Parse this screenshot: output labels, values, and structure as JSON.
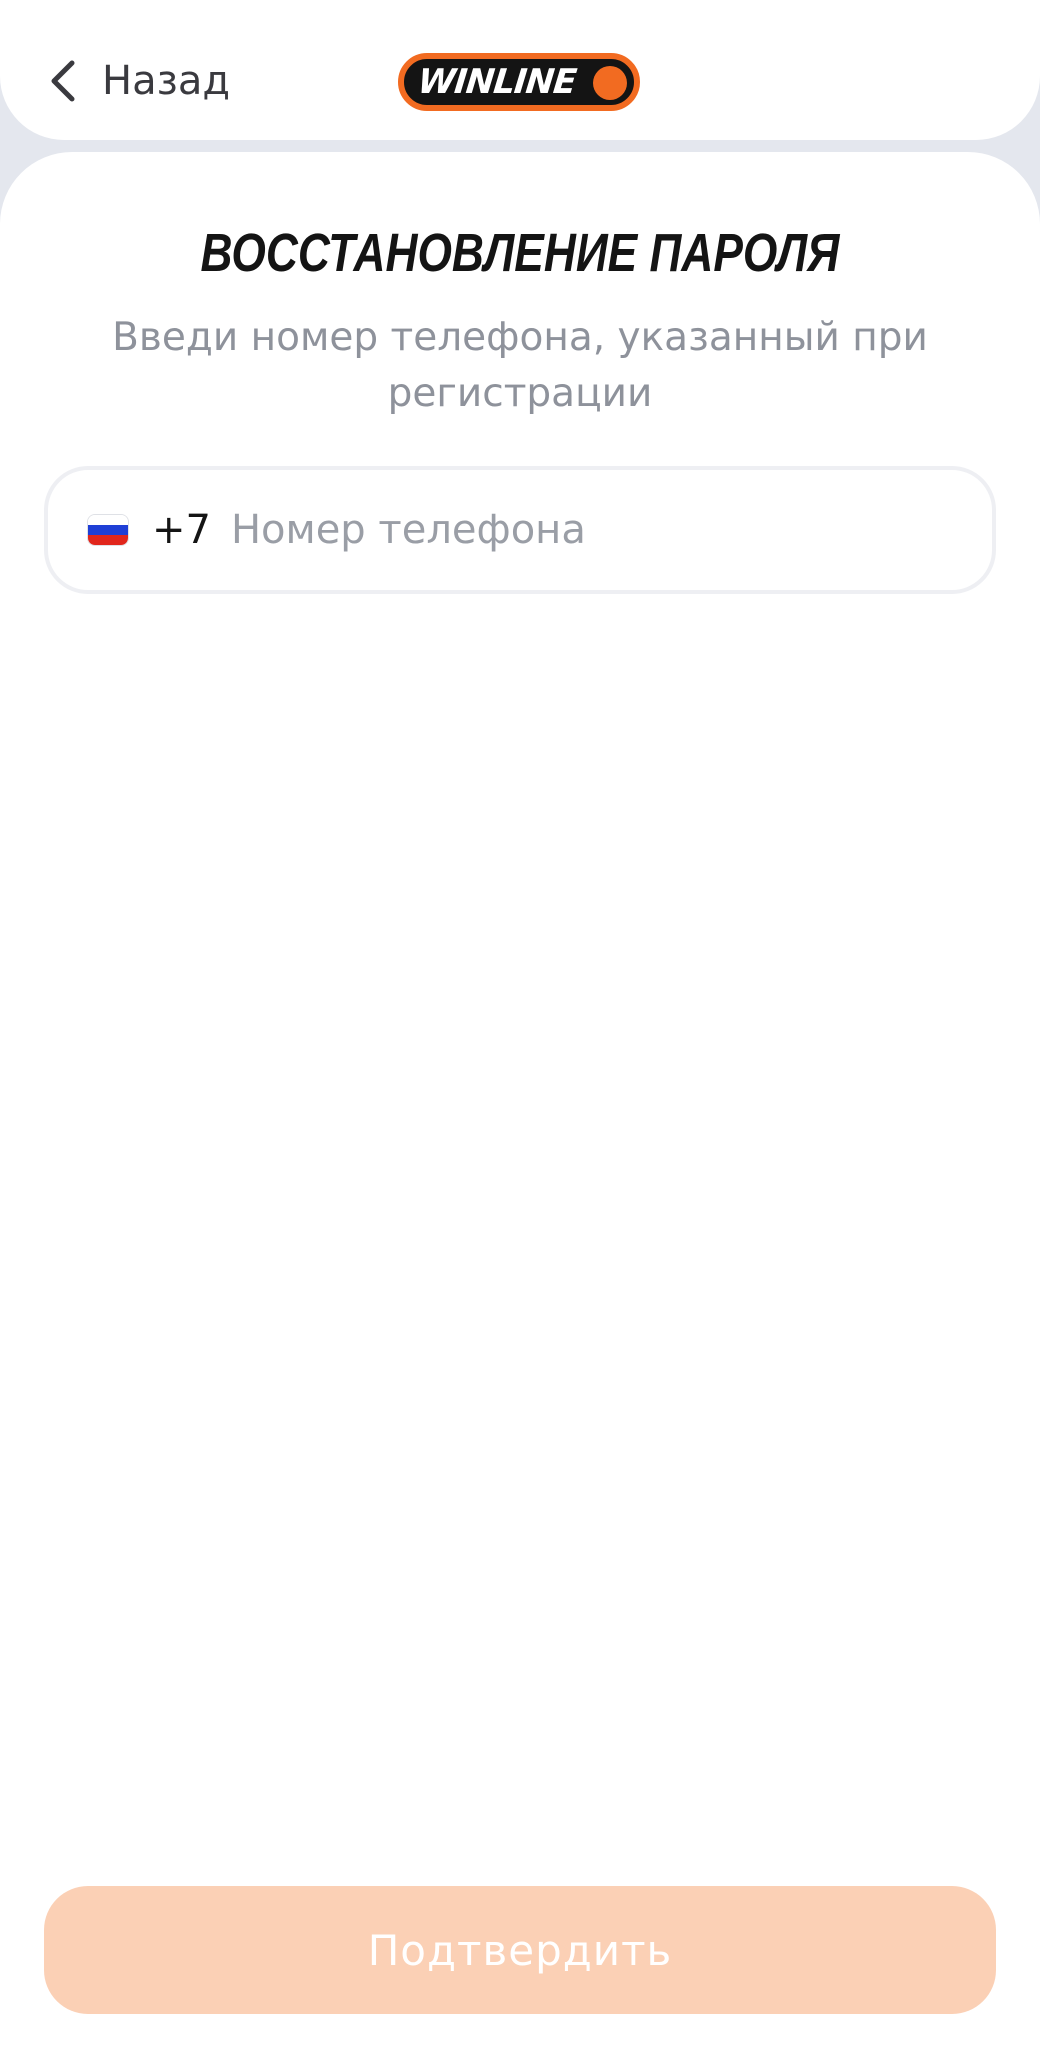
{
  "header": {
    "back_label": "Назад",
    "logo_text": "WINLINE"
  },
  "main": {
    "title": "ВОССТАНОВЛЕНИЕ ПАРОЛЯ",
    "subtitle": "Введи номер телефона, указанный при регистрации",
    "phone": {
      "country_prefix": "+7",
      "placeholder": "Номер телефона",
      "value": "",
      "flag_icon": "russia-flag-icon"
    },
    "submit_label": "Подтвердить"
  },
  "colors": {
    "brand_orange": "#f26b21",
    "button_disabled": "#fbd0b5",
    "page_background": "#e4e7ee",
    "muted_text": "#8e929b"
  }
}
